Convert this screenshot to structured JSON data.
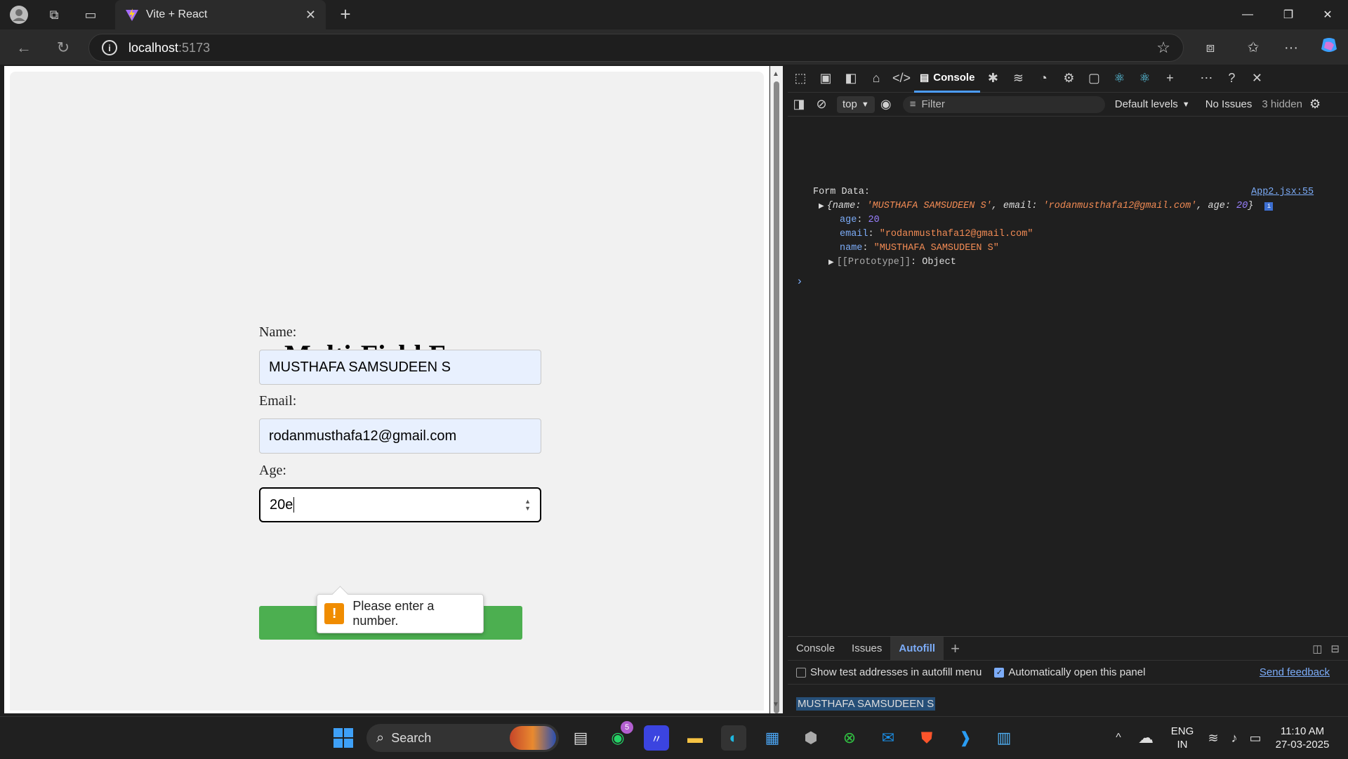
{
  "browser": {
    "tab_title": "Vite + React",
    "url_host": "localhost",
    "url_port": ":5173"
  },
  "form": {
    "heading": "Multi-Field Form",
    "name_label": "Name:",
    "name_value": "MUSTHAFA SAMSUDEEN S",
    "email_label": "Email:",
    "email_value": "rodanmusthafa12@gmail.com",
    "age_label": "Age:",
    "age_value": "20e",
    "validation_message": "Please enter a number."
  },
  "devtools": {
    "console_tab": "Console",
    "context": "top",
    "filter_placeholder": "Filter",
    "levels": "Default levels",
    "issues": "No Issues",
    "hidden": "3 hidden",
    "log_label": "Form Data:",
    "log_source": "App2.jsx:55",
    "preview_open": "{name: ",
    "preview_name": "'MUSTHAFA SAMSUDEEN S'",
    "preview_email_key": ", email: ",
    "preview_email": "'rodanmusthafa12@gmail.com'",
    "preview_age_key": ", age: ",
    "preview_age": "20",
    "preview_close": "}",
    "age_key": "age",
    "age_val": "20",
    "email_key": "email",
    "email_val": "\"rodanmusthafa12@gmail.com\"",
    "name_key": "name",
    "name_val": "\"MUSTHAFA SAMSUDEEN S\"",
    "proto_key": "[[Prototype]]",
    "proto_val": "Object",
    "drawer_tabs": [
      "Console",
      "Issues",
      "Autofill"
    ],
    "autofill_opt1": "Show test addresses in autofill menu",
    "autofill_opt2": "Automatically open this panel",
    "send_feedback": "Send feedback",
    "autofill_value": "MUSTHAFA SAMSUDEEN S"
  },
  "taskbar": {
    "search_label": "Search",
    "whatsapp_badge": "5",
    "lang1": "ENG",
    "lang2": "IN",
    "time": "11:10 AM",
    "date": "27-03-2025"
  }
}
